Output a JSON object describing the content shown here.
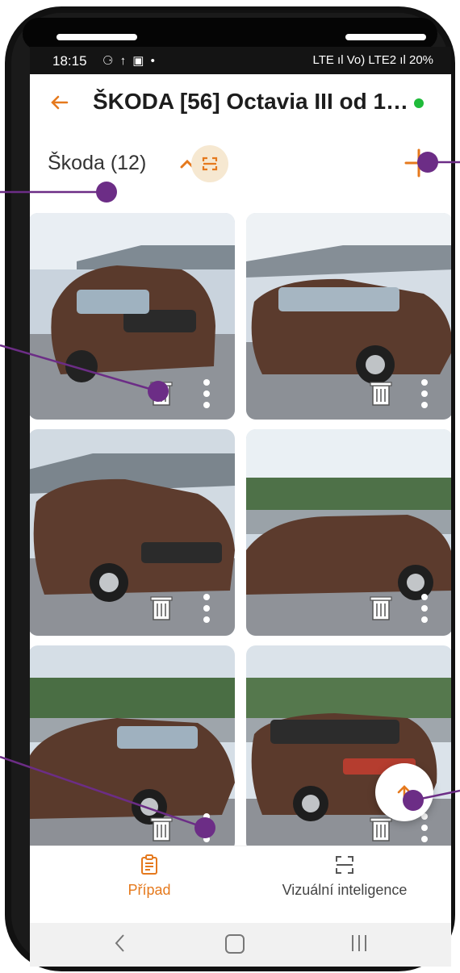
{
  "status_bar": {
    "time": "18:15",
    "icons": "⚆ ↑ ▣ •",
    "signal": "LTE ıl Vo) LTE2 ıl 20%"
  },
  "app_bar": {
    "title": "ŠKODA [56] Octavia III od 1…",
    "status_color": "#1fbb3a"
  },
  "group": {
    "label": "Škoda (12)",
    "accent": "#e5791d"
  },
  "photos": [
    {
      "name": "photo-1"
    },
    {
      "name": "photo-2"
    },
    {
      "name": "photo-3"
    },
    {
      "name": "photo-4"
    },
    {
      "name": "photo-5"
    },
    {
      "name": "photo-6"
    }
  ],
  "bottom_nav": {
    "case_label": "Případ",
    "visual_label": "Vizuální inteligence"
  },
  "colors": {
    "accent": "#e5791d",
    "pointer": "#6c2d86"
  }
}
